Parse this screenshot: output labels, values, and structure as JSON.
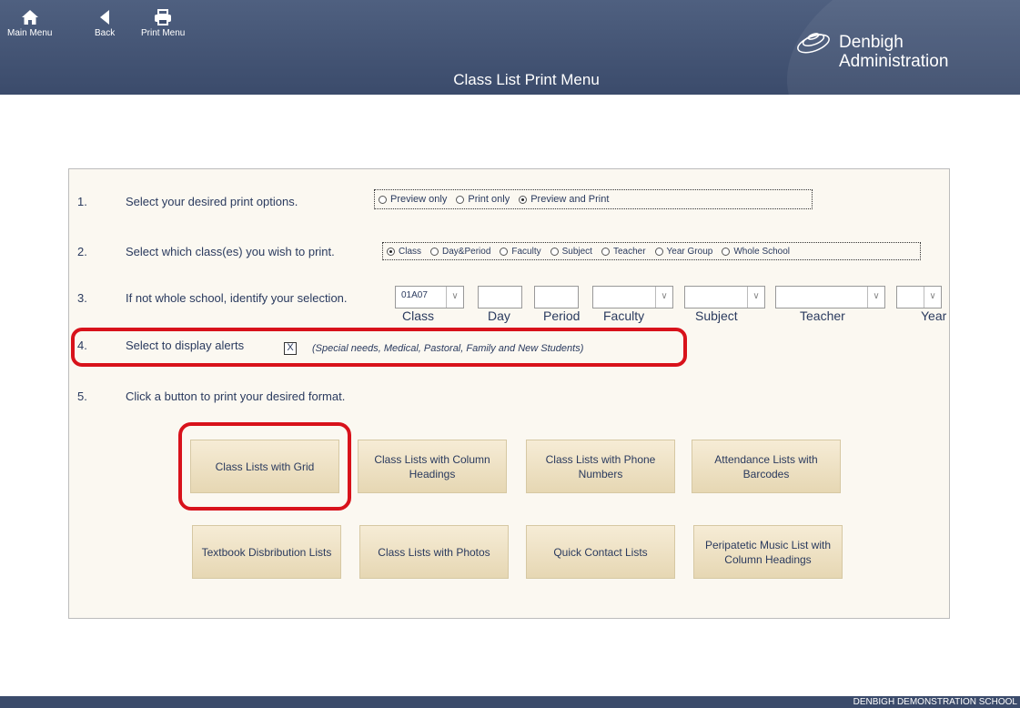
{
  "header": {
    "buttons": [
      {
        "label": "Main Menu",
        "icon": "home-icon"
      },
      {
        "label": "Back",
        "icon": "back-arrow-icon"
      },
      {
        "label": "Print Menu",
        "icon": "printer-icon"
      }
    ],
    "title": "Class List Print Menu",
    "brand_line1": "Denbigh",
    "brand_line2": "Administration"
  },
  "steps": {
    "s1": {
      "num": "1.",
      "label": "Select your desired print options.",
      "options": [
        "Preview only",
        "Print only",
        "Preview and Print"
      ],
      "selected": "Preview and Print"
    },
    "s2": {
      "num": "2.",
      "label": "Select which class(es) you wish to print.",
      "options": [
        "Class",
        "Day&Period",
        "Faculty",
        "Subject",
        "Teacher",
        "Year Group",
        "Whole School"
      ],
      "selected": "Class"
    },
    "s3": {
      "num": "3.",
      "label": "If not whole school, identify your selection.",
      "fields": {
        "class_value": "01A07",
        "day_value": "",
        "period_value": "",
        "faculty_value": "",
        "subject_value": "",
        "teacher_value": "",
        "year_value": ""
      },
      "field_labels": {
        "class": "Class",
        "day": "Day",
        "period": "Period",
        "faculty": "Faculty",
        "subject": "Subject",
        "teacher": "Teacher",
        "year": "Year"
      }
    },
    "s4": {
      "num": "4.",
      "label": "Select to display alerts",
      "checked_mark": "X",
      "hint": "(Special needs, Medical, Pastoral, Family and New Students)"
    },
    "s5": {
      "num": "5.",
      "label": "Click a button to print your desired format."
    }
  },
  "buttons": {
    "b1": "Class Lists with Grid",
    "b2": "Class Lists with Column Headings",
    "b3": "Class Lists with Phone Numbers",
    "b4": "Attendance Lists with Barcodes",
    "b5": "Textbook Disbribution Lists",
    "b6": "Class Lists with Photos",
    "b7": "Quick Contact Lists",
    "b8": "Peripatetic Music List with Column Headings"
  },
  "footer": {
    "school": "DENBIGH DEMONSTRATION SCHOOL"
  },
  "colors": {
    "header_bg": "#3b4b6b",
    "panel_bg": "#fbf8f1",
    "button_bg": "#eee2c4",
    "highlight": "#d8121b",
    "text": "#2a3a5e"
  }
}
